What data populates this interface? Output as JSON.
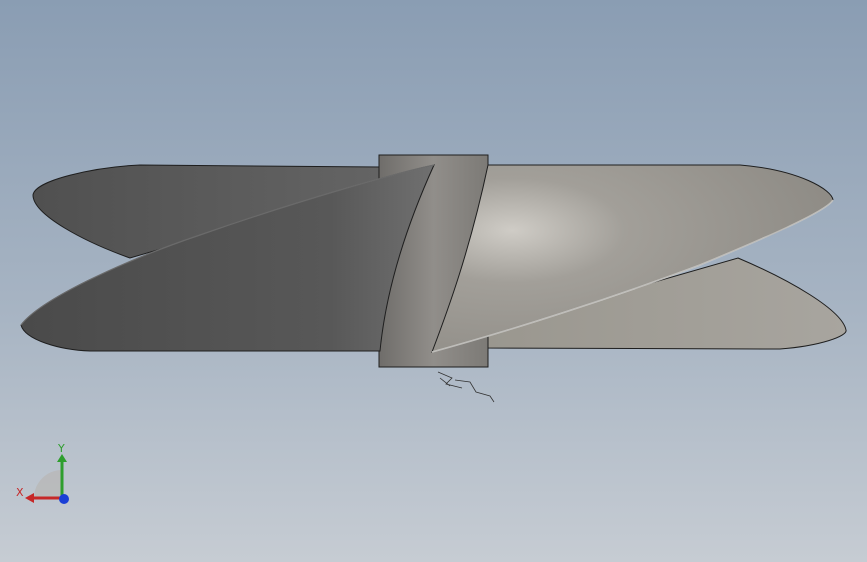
{
  "viewport": {
    "background_top": "#8a9db3",
    "background_bottom": "#c6ccd3"
  },
  "model": {
    "part": "propeller",
    "blade_count": 2,
    "dark_blade_color": "#5a5a5a",
    "light_blade_color": "#a6a39d",
    "hub_color": "#868380",
    "edge_color": "#1e1e1e"
  },
  "triad": {
    "x_label": "X",
    "y_label": "Y",
    "x_color": "#c62828",
    "y_color": "#2e9e2e",
    "z_color": "#1a3fd6"
  }
}
